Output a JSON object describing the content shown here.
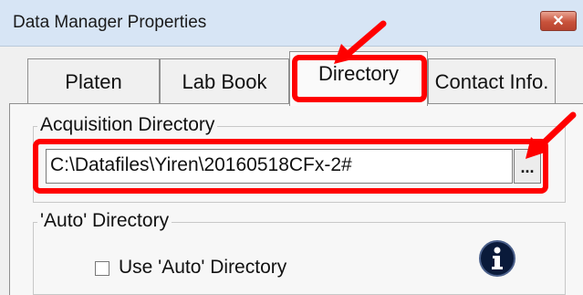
{
  "window": {
    "title": "Data Manager Properties",
    "close_glyph": "✕"
  },
  "tabs": [
    {
      "label": "Platen",
      "active": false
    },
    {
      "label": "Lab Book",
      "active": false
    },
    {
      "label": "Directory",
      "active": true
    },
    {
      "label": "Contact Info.",
      "active": false
    }
  ],
  "acquisition": {
    "group_title": "Acquisition Directory",
    "path_value": "C:\\Datafiles\\Yiren\\20160518CFx-2#",
    "browse_label": "..."
  },
  "auto": {
    "group_title": "'Auto' Directory",
    "checkbox_label": "Use 'Auto' Directory",
    "checked": false,
    "info_icon": "info-icon"
  },
  "colors": {
    "annotation": "#ff0000",
    "titlebar": "#d7e5f5",
    "close_button": "#c8523b"
  }
}
